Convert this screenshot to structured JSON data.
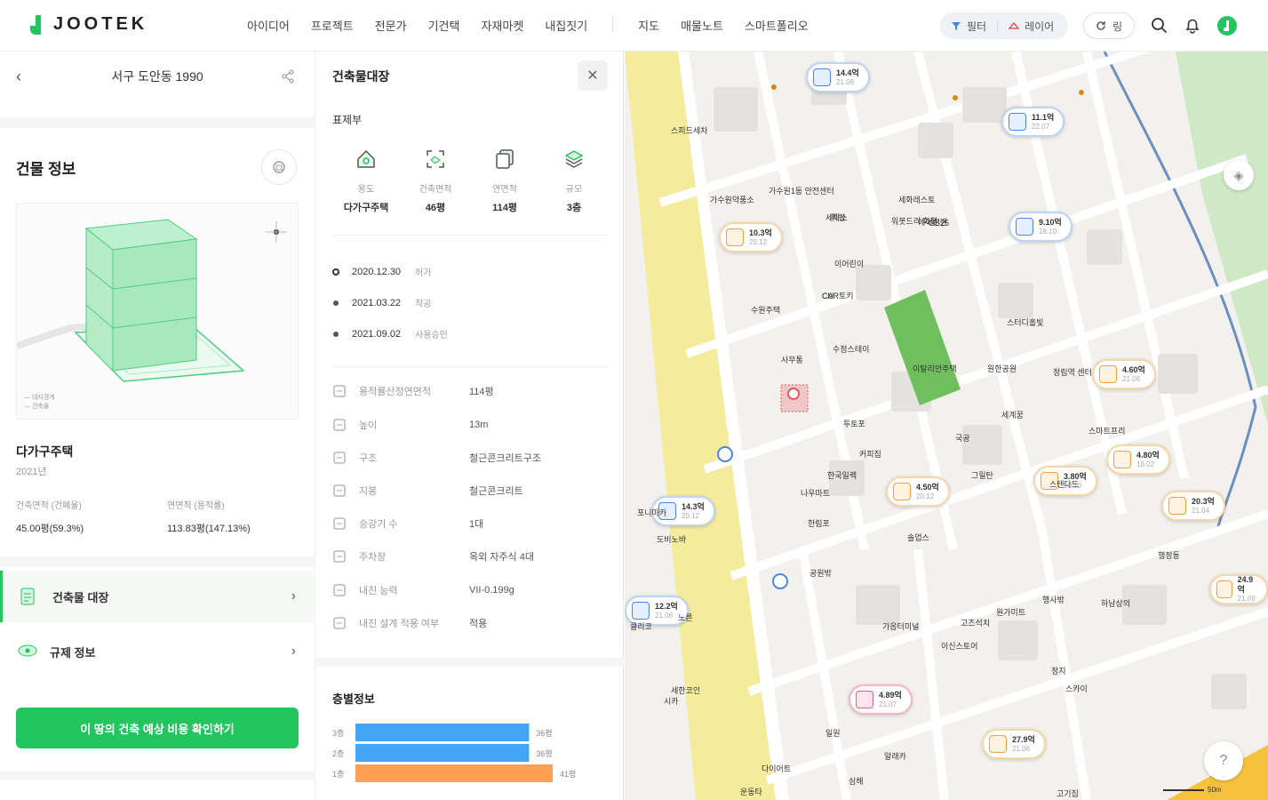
{
  "header": {
    "logo_text": "JOOTEK",
    "nav": [
      "아이디어",
      "프로젝트",
      "전문가",
      "기건택",
      "자재마켓",
      "내집짓기",
      "지도",
      "매물노트",
      "스마트폴리오"
    ],
    "filter_label": "필터",
    "layer_label": "레이어",
    "refresh_label": "링"
  },
  "left": {
    "address": "서구 도안동 1990",
    "section_title": "건물 정보",
    "legend": [
      "대지경계",
      "건축물"
    ],
    "building_type": "다가구주택",
    "year": "2021년",
    "stats": [
      {
        "label": "건축면적 (건폐율)",
        "value": "45.00평(59.3%)"
      },
      {
        "label": "연면적 (용적률)",
        "value": "113.83평(147.13%)"
      }
    ],
    "menu": [
      "건축물 대장",
      "규제 정보"
    ],
    "cta": "이 땅의 건축 예상 비용 확인하기"
  },
  "middle": {
    "title": "건축물대장",
    "subtitle": "표제부",
    "kpis": [
      {
        "label": "용도",
        "value": "다가구주택",
        "icon": "house-icon"
      },
      {
        "label": "건축면적",
        "value": "46평",
        "icon": "area-icon"
      },
      {
        "label": "연면적",
        "value": "114평",
        "icon": "copy-icon"
      },
      {
        "label": "규모",
        "value": "3층",
        "icon": "layers-icon"
      }
    ],
    "timeline": [
      {
        "date": "2020.12.30",
        "status": "허가"
      },
      {
        "date": "2021.03.22",
        "status": "착공"
      },
      {
        "date": "2021.09.02",
        "status": "사용승인"
      }
    ],
    "details": [
      {
        "key": "용적률산정연면적",
        "value": "114평",
        "icon": "expand-icon"
      },
      {
        "key": "높이",
        "value": "13m",
        "icon": "height-icon"
      },
      {
        "key": "구조",
        "value": "철근콘크리트구조",
        "icon": "structure-icon"
      },
      {
        "key": "지붕",
        "value": "철근콘크리트",
        "icon": "roof-icon"
      },
      {
        "key": "승강기 수",
        "value": "1대",
        "icon": "elevator-icon"
      },
      {
        "key": "주차장",
        "value": "옥외 자주식 4대",
        "icon": "parking-icon"
      },
      {
        "key": "내진 능력",
        "value": "VII-0.199g",
        "icon": "edit-icon"
      },
      {
        "key": "내진 설계 적용 여부",
        "value": "적용",
        "icon": "edit-icon"
      }
    ],
    "floor_title": "층별정보",
    "floors": [
      {
        "floor": "3층",
        "area": "36평",
        "color": "#42a5f5",
        "ratio": 0.88
      },
      {
        "floor": "2층",
        "area": "36평",
        "color": "#42a5f5",
        "ratio": 0.88
      },
      {
        "floor": "1층",
        "area": "41평",
        "color": "#ff9f55",
        "ratio": 1.0
      }
    ]
  },
  "map": {
    "badges": [
      {
        "type": "blue",
        "t1": "14.4억",
        "t2": "21.08"
      },
      {
        "type": "blue",
        "t1": "11.1억",
        "t2": "22.07"
      },
      {
        "type": "blue",
        "t1": "9.10억",
        "t2": "18.10"
      },
      {
        "type": "orange",
        "t1": "10.3억",
        "t2": "20.12"
      },
      {
        "type": "orange",
        "t1": "4.60억",
        "t2": "21.06"
      },
      {
        "type": "orange",
        "t1": "4.80억",
        "t2": "18.02"
      },
      {
        "type": "orange",
        "t1": "4.50억",
        "t2": "20.12"
      },
      {
        "type": "orange",
        "t1": "3.80억",
        "t2": "20.10"
      },
      {
        "type": "orange",
        "t1": "20.3억",
        "t2": "21.04"
      },
      {
        "type": "blue",
        "t1": "14.3억",
        "t2": "20.12"
      },
      {
        "type": "orange",
        "t1": "24.9억",
        "t2": "21.09"
      },
      {
        "type": "blue",
        "t1": "12.2억",
        "t2": "21.06"
      },
      {
        "type": "pink",
        "t1": "4.89억",
        "t2": "21.07"
      },
      {
        "type": "orange",
        "t1": "27.9억",
        "t2": "21.06"
      }
    ],
    "places": [
      "스피드세차",
      "가수원약품소",
      "가수원1동 안전센터",
      "세탁소",
      "세화레스토",
      "수원주택",
      "CU",
      "워킹",
      "워봇드리 화학",
      "에이신랜",
      "이어린이",
      "GS25",
      "CAR토키",
      "사무통",
      "수정스테이",
      "이탈리안주택",
      "원한공원",
      "스터디홀빛",
      "정림역 센터",
      "세계꿈",
      "투토포",
      "한국일렉",
      "커피집",
      "나우마트",
      "포니마카",
      "도비노바",
      "세한코인",
      "시카",
      "솔업스",
      "한림포",
      "공원밖",
      "가음터미널",
      "고즈석치",
      "행사밖",
      "이신스토어",
      "원가미트",
      "노른",
      "다이어트",
      "운동타",
      "정지",
      "알래카",
      "스마트프리",
      "스탠다드",
      "국공",
      "그릴탄",
      "클리코",
      "스카이",
      "하남상의",
      "일원",
      "고기집",
      "심해",
      "행정동"
    ],
    "scale": "50m",
    "help": "?"
  }
}
